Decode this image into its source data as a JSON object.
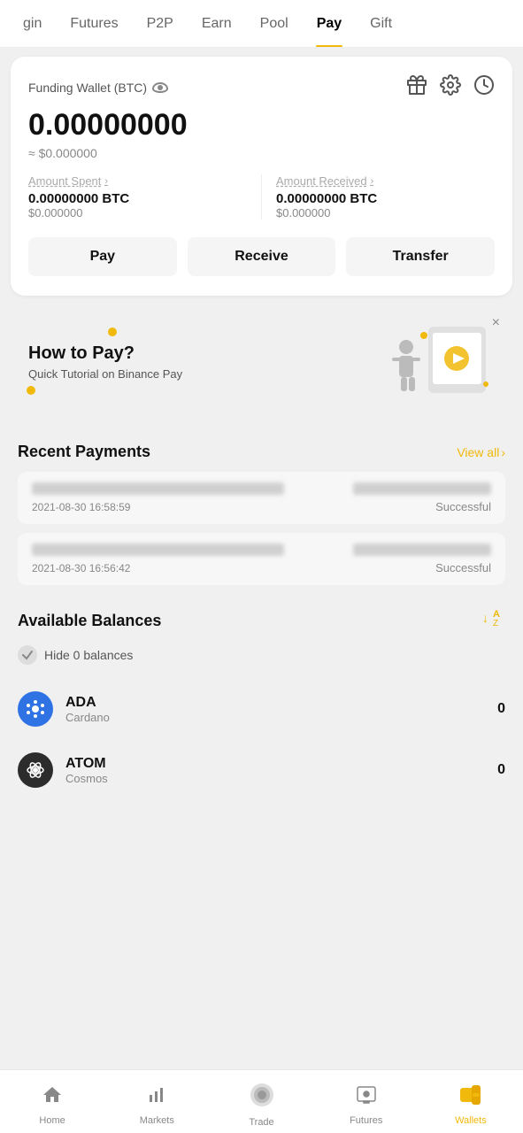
{
  "nav": {
    "items": [
      {
        "id": "margin",
        "label": "gin",
        "active": false
      },
      {
        "id": "futures",
        "label": "Futures",
        "active": false
      },
      {
        "id": "p2p",
        "label": "P2P",
        "active": false
      },
      {
        "id": "earn",
        "label": "Earn",
        "active": false
      },
      {
        "id": "pool",
        "label": "Pool",
        "active": false
      },
      {
        "id": "pay",
        "label": "Pay",
        "active": true
      },
      {
        "id": "gift",
        "label": "Gift",
        "active": false
      }
    ]
  },
  "wallet": {
    "title": "Funding Wallet (BTC)",
    "amount": "0.00000000",
    "usd_approx": "≈ $0.000000",
    "spent_label": "Amount Spent",
    "received_label": "Amount Received",
    "spent_btc": "0.00000000 BTC",
    "spent_usd": "$0.000000",
    "received_btc": "0.00000000 BTC",
    "received_usd": "$0.000000"
  },
  "actions": {
    "pay": "Pay",
    "receive": "Receive",
    "transfer": "Transfer"
  },
  "banner": {
    "title": "How to Pay?",
    "subtitle": "Quick Tutorial on Binance Pay",
    "close": "×"
  },
  "recent_payments": {
    "title": "Recent Payments",
    "view_all": "View all",
    "payments": [
      {
        "time": "2021-08-30 16:58:59",
        "status": "Successful"
      },
      {
        "time": "2021-08-30 16:56:42",
        "status": "Successful"
      }
    ]
  },
  "balances": {
    "title": "Available Balances",
    "hide_zero_label": "Hide 0 balances",
    "coins": [
      {
        "symbol": "ADA",
        "name": "Cardano",
        "amount": "0",
        "icon_type": "ada"
      },
      {
        "symbol": "ATOM",
        "name": "Cosmos",
        "amount": "0",
        "icon_type": "atom"
      }
    ]
  },
  "bottom_nav": {
    "items": [
      {
        "id": "home",
        "label": "Home",
        "icon": "🏠",
        "active": false
      },
      {
        "id": "markets",
        "label": "Markets",
        "icon": "📊",
        "active": false
      },
      {
        "id": "trade",
        "label": "Trade",
        "icon": "⚪",
        "active": false
      },
      {
        "id": "futures",
        "label": "Futures",
        "icon": "📺",
        "active": false
      },
      {
        "id": "wallets",
        "label": "Wallets",
        "icon": "💛",
        "active": true
      }
    ]
  }
}
